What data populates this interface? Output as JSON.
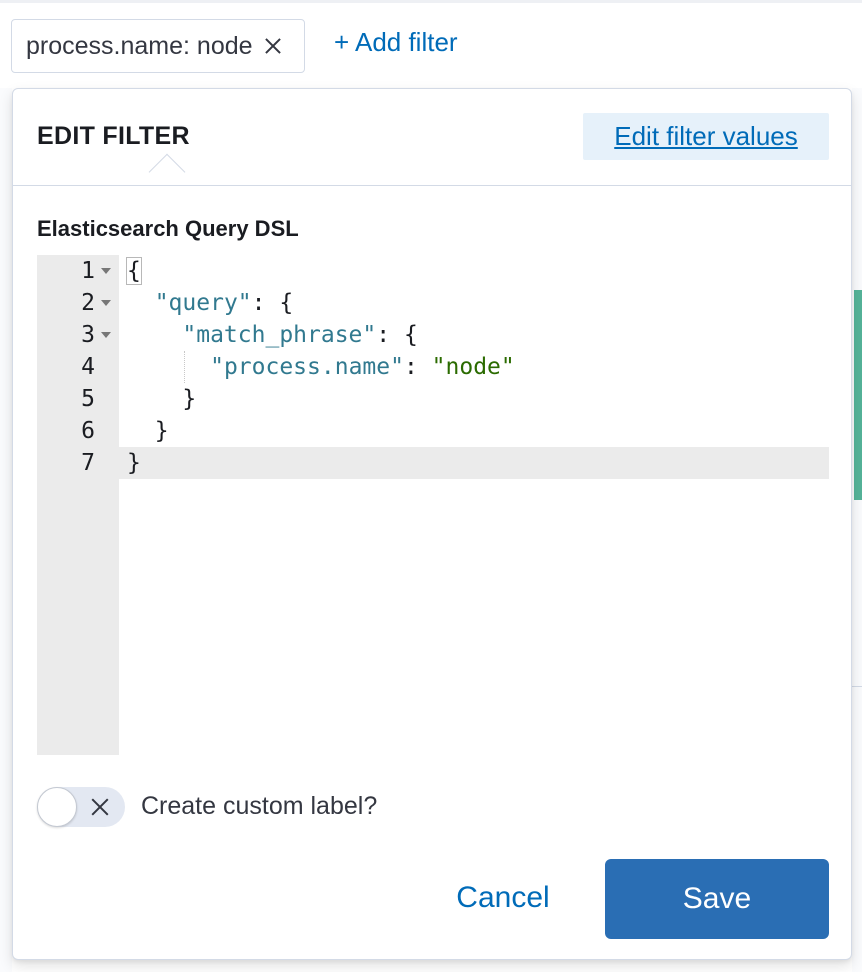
{
  "filter_bar": {
    "pill_label": "process.name: node",
    "add_filter_label": "+ Add filter"
  },
  "popover": {
    "title": "EDIT FILTER",
    "edit_values_link": "Edit filter values",
    "dsl_label": "Elasticsearch Query DSL",
    "editor": {
      "lines": [
        {
          "number": "1",
          "foldable": true
        },
        {
          "number": "2",
          "foldable": true
        },
        {
          "number": "3",
          "foldable": true
        },
        {
          "number": "4",
          "foldable": false
        },
        {
          "number": "5",
          "foldable": false
        },
        {
          "number": "6",
          "foldable": false
        },
        {
          "number": "7",
          "foldable": false
        }
      ],
      "tokens": {
        "open_brace": "{",
        "query_key": "\"query\"",
        "match_phrase_key": "\"match_phrase\"",
        "field_key": "\"process.name\"",
        "field_value": "\"node\"",
        "colon_brace": ": {",
        "colon": ": ",
        "close_brace": "}"
      },
      "active_line": "7"
    },
    "custom_label_toggle": {
      "label": "Create custom label?",
      "checked": false
    },
    "cancel_label": "Cancel",
    "save_label": "Save"
  },
  "colors": {
    "accent": "#006bb8",
    "primary_button": "#2a6eb4",
    "json_key": "#31798f",
    "json_string": "#2b6b00"
  }
}
